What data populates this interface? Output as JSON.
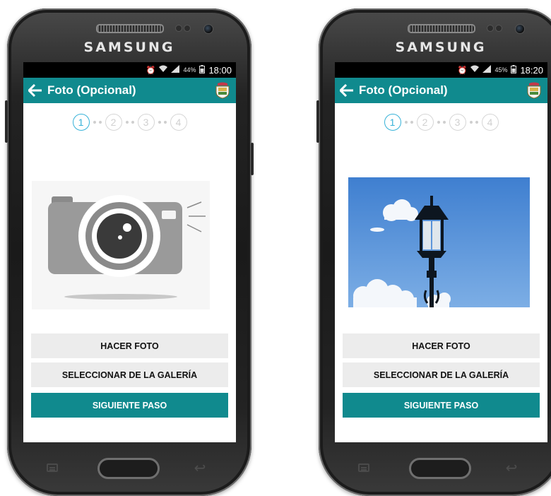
{
  "phones": [
    {
      "brand": "SAMSUNG",
      "status": {
        "time": "18:00",
        "battery": "44%"
      },
      "app": {
        "title": "Foto (Opcional)"
      },
      "steps": [
        "1",
        "2",
        "3",
        "4"
      ],
      "active_step": 1,
      "photo": "camera-placeholder",
      "buttons": {
        "take_photo": "HACER FOTO",
        "gallery": "SELECCIONAR DE LA GALERÍA",
        "next": "SIGUIENTE PASO"
      }
    },
    {
      "brand": "SAMSUNG",
      "status": {
        "time": "18:20",
        "battery": "45%"
      },
      "app": {
        "title": "Foto (Opcional)"
      },
      "steps": [
        "1",
        "2",
        "3",
        "4"
      ],
      "active_step": 1,
      "photo": "street-lamp-photo",
      "buttons": {
        "take_photo": "HACER FOTO",
        "gallery": "SELECCIONAR DE LA GALERÍA",
        "next": "SIGUIENTE PASO"
      }
    }
  ],
  "colors": {
    "appbar": "#108a8e",
    "active_step": "#36b2d8",
    "secondary_button": "#ececec"
  }
}
